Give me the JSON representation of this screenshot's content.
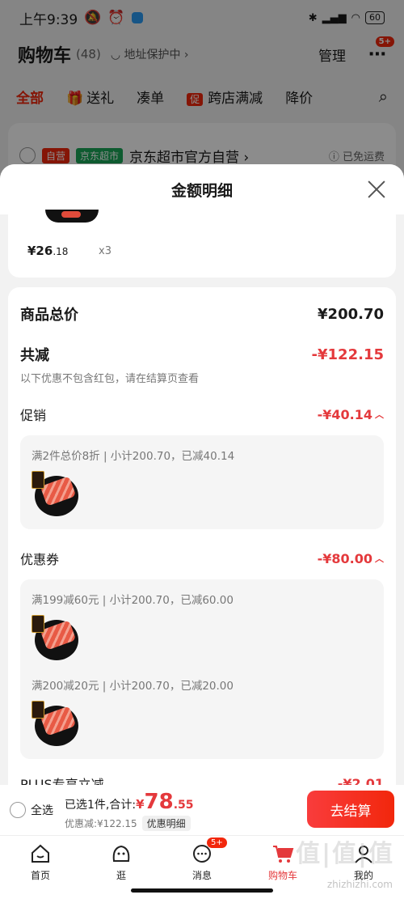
{
  "status": {
    "time": "上午9:39",
    "battery": "60"
  },
  "header": {
    "title": "购物车",
    "count": "(48)",
    "address": "地址保护中",
    "manage": "管理",
    "more_badge": "5+"
  },
  "filters": {
    "all": "全部",
    "gift": "送礼",
    "combine": "凑单",
    "promo_tag": "促",
    "cross_shop": "跨店满减",
    "price_drop": "降价"
  },
  "shop": {
    "tag_self": "自营",
    "tag_market": "京东超市",
    "name": "京东超市官方自营",
    "free_shipping": "已免运费"
  },
  "sheet": {
    "title": "金额明细",
    "item": {
      "price_main": "¥26",
      "price_cents": ".18",
      "qty": "x3"
    },
    "total_label": "商品总价",
    "total_value": "¥200.70",
    "reduce_label": "共减",
    "reduce_value": "-¥122.15",
    "note": "以下优惠不包含红包，请在结算页查看",
    "promo_label": "促销",
    "promo_value": "-¥40.14",
    "promo_line": "满2件总价8折 | 小计200.70，已减40.14",
    "coupon_label": "优惠券",
    "coupon_value": "-¥80.00",
    "coupon_line1": "满199减60元 | 小计200.70，已减60.00",
    "coupon_line2": "满200减20元 | 小计200.70，已减20.00",
    "plus_label": "PLUS专享立减",
    "plus_value": "-¥2.01"
  },
  "checkout": {
    "select_all": "全选",
    "selected_text": "已选1件,合计:",
    "yen": "¥",
    "amount_main": "78",
    "amount_cents": ".55",
    "discount_text": "优惠减:¥122.15",
    "detail_chip": "优惠明细",
    "button": "去结算"
  },
  "tabs": [
    {
      "label": "首页"
    },
    {
      "label": "逛"
    },
    {
      "label": "消息",
      "badge": "5+"
    },
    {
      "label": "购物车"
    },
    {
      "label": "我的"
    }
  ],
  "watermark": {
    "logo": "值|值|值",
    "url": "zhizhizhi.com"
  },
  "colors": {
    "accent": "#e4393c",
    "brand": "#f2270c",
    "green": "#1aa658"
  }
}
